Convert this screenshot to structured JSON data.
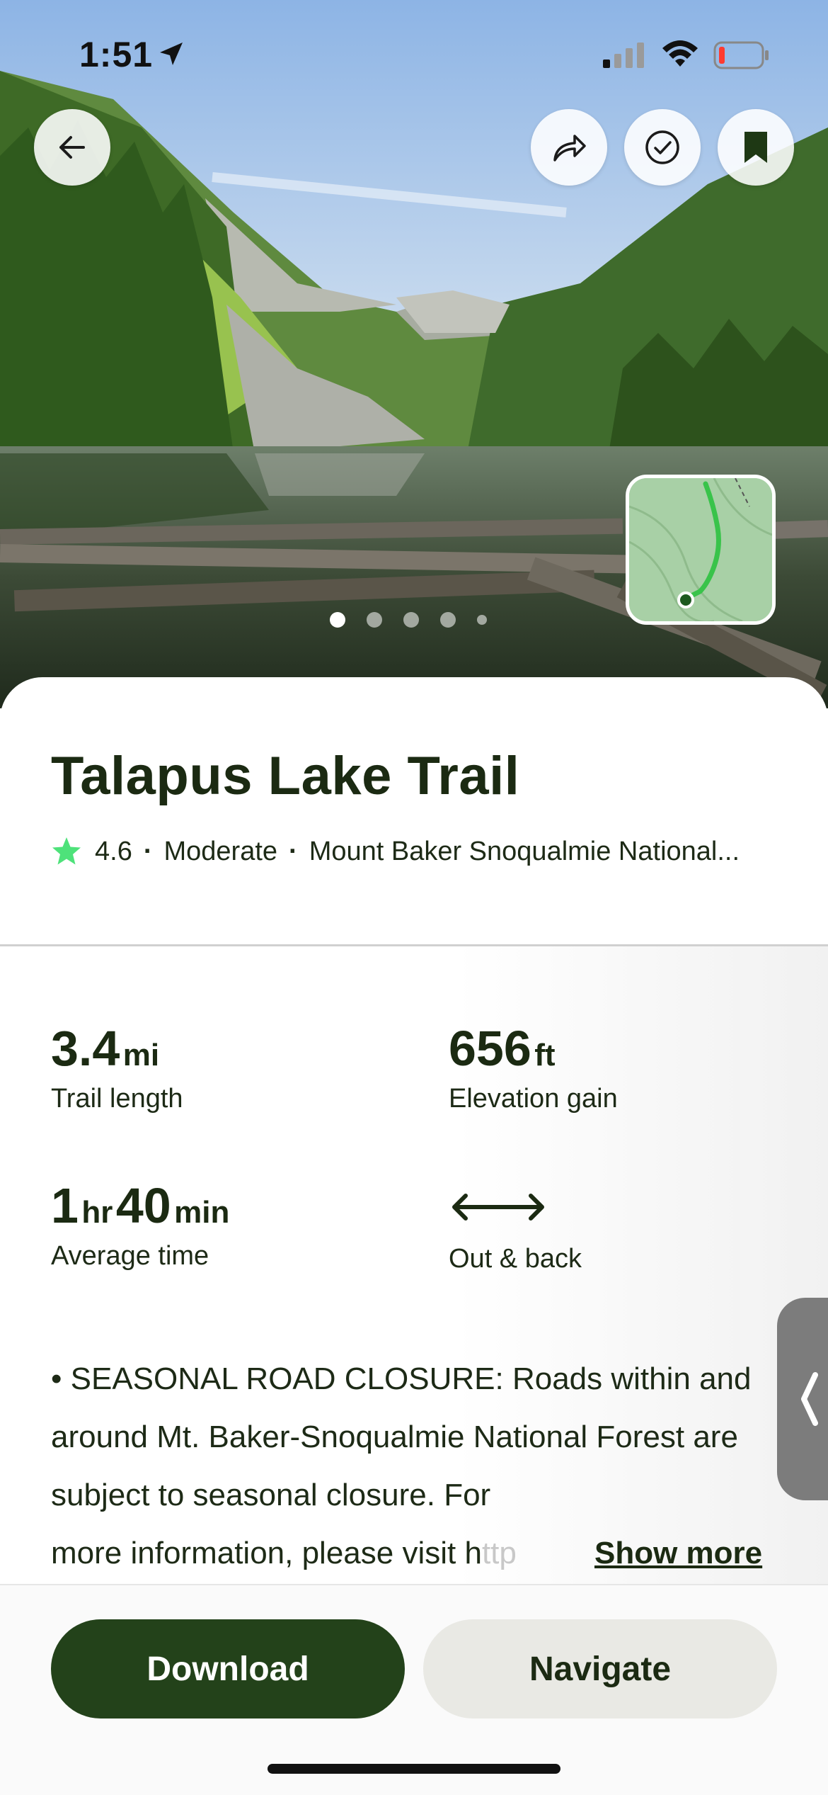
{
  "status_bar": {
    "time": "1:51"
  },
  "hero": {
    "photo_count": 5,
    "active_photo": 1
  },
  "trail": {
    "name": "Talapus Lake Trail",
    "rating": "4.6",
    "difficulty": "Moderate",
    "location": "Mount Baker Snoqualmie National..."
  },
  "stats": {
    "length": {
      "value": "3.4",
      "unit": "mi",
      "label": "Trail length"
    },
    "elevation": {
      "value": "656",
      "unit": "ft",
      "label": "Elevation gain"
    },
    "time": {
      "hours": "1",
      "hours_unit": "hr",
      "minutes": "40",
      "minutes_unit": "min",
      "label": "Average time"
    },
    "route": {
      "label": "Out & back"
    }
  },
  "description": {
    "text": "• SEASONAL ROAD CLOSURE: Roads within and around Mt. Baker-Snoqualmie National Forest are subject to seasonal closure. For",
    "last_line": "more information, please visit h",
    "last_line_faded": "ttp",
    "show_more": "Show more"
  },
  "actions": {
    "download": "Download",
    "navigate": "Navigate"
  },
  "colors": {
    "accent": "#23421a",
    "star": "#4ee27a"
  }
}
